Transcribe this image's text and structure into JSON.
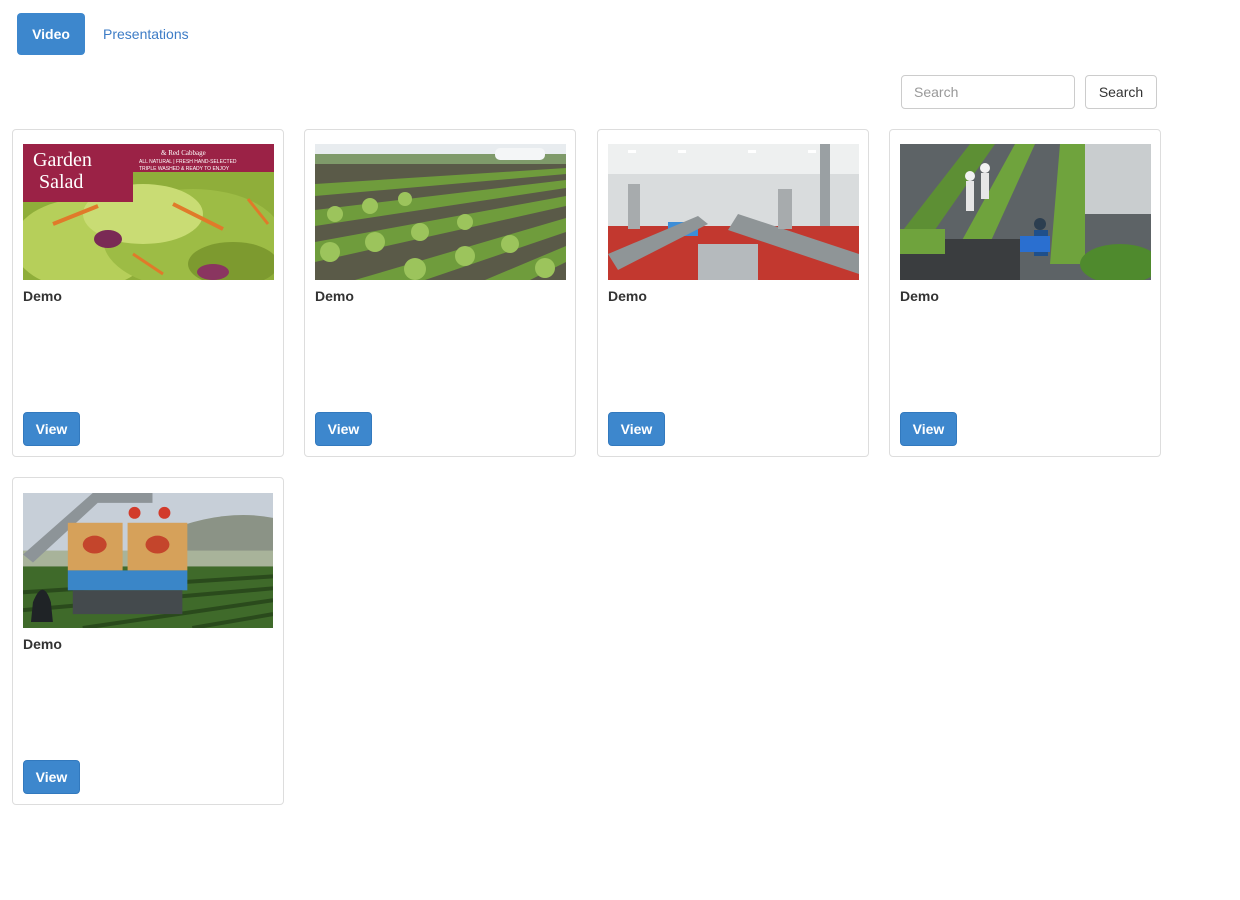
{
  "tabs": [
    {
      "label": "Video",
      "active": true
    },
    {
      "label": "Presentations",
      "active": false
    }
  ],
  "search": {
    "placeholder": "Search",
    "value": "",
    "button_label": "Search"
  },
  "cards": [
    {
      "title": "Demo",
      "button_label": "View",
      "thumb": "garden-salad-package",
      "thumb_text": {
        "line1": "Garden",
        "line2": "Salad",
        "sub": "& Red Cabbage",
        "tag1": "ALL NATURAL | FRESH HAND-SELECTED",
        "tag2": "TRIPLE WASHED & READY TO ENJOY"
      }
    },
    {
      "title": "Demo",
      "button_label": "View",
      "thumb": "lettuce-field"
    },
    {
      "title": "Demo",
      "button_label": "View",
      "thumb": "factory-interior"
    },
    {
      "title": "Demo",
      "button_label": "View",
      "thumb": "processing-conveyor"
    },
    {
      "title": "Demo",
      "button_label": "View",
      "thumb": "harvest-machine"
    }
  ],
  "colors": {
    "primary": "#3d87cd",
    "link": "#3d7cc6",
    "border": "#dddddd"
  }
}
